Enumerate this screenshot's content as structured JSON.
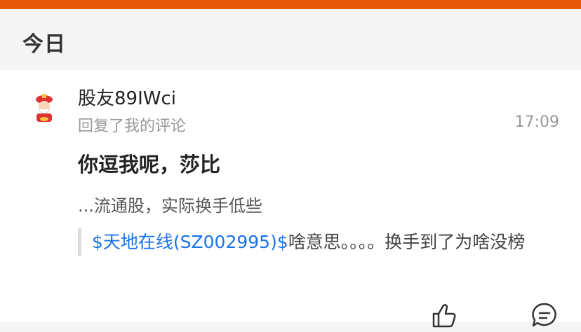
{
  "section": {
    "title": "今日"
  },
  "notification": {
    "username": "股友89IWci",
    "action": "回复了我的评论",
    "time": "17:09",
    "reply_text": "你逗我呢，莎比",
    "original_excerpt": "...流通股，实际换手低些",
    "quoted_post": {
      "link_text": "$天地在线(SZ002995)$",
      "text": "啥意思。。。。换手到了为啥没榜"
    }
  },
  "actions": {
    "like_icon": "thumbs-up-icon",
    "comment_icon": "comment-icon"
  },
  "colors": {
    "accent": "#e8590c",
    "link": "#1a73e8",
    "muted": "#999999"
  }
}
